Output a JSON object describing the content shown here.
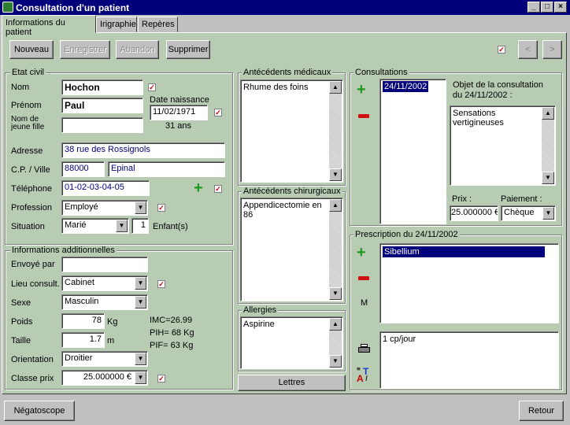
{
  "window": {
    "title": "Consultation d'un patient"
  },
  "tabs": [
    {
      "label": "Informations du patient"
    },
    {
      "label": "Irigraphie"
    },
    {
      "label": "Repères"
    }
  ],
  "toolbar": {
    "nouveau": "Nouveau",
    "enregistrer": "Enregistrer",
    "abandon": "Abandon",
    "supprimer": "Supprimer",
    "prev": "<",
    "next": ">"
  },
  "etat_civil": {
    "title": "Etat civil",
    "nom_label": "Nom",
    "nom": "Hochon",
    "prenom_label": "Prénom",
    "prenom": "Paul",
    "jeune_fille_label": "Nom de jeune fille",
    "jeune_fille": "",
    "date_naissance_label": "Date naissance",
    "date_naissance": "11/02/1971",
    "age": "31 ans",
    "adresse_label": "Adresse",
    "adresse": "38 rue des Rossignols",
    "cp_ville_label": "C.P. / Ville",
    "cp": "88000",
    "ville": "Epinal",
    "telephone_label": "Téléphone",
    "telephone": "01-02-03-04-05",
    "profession_label": "Profession",
    "profession": "Employé",
    "situation_label": "Situation",
    "situation": "Marié",
    "enfants": "1",
    "enfants_label": "Enfant(s)"
  },
  "infos_add": {
    "title": "Informations additionnelles",
    "envoye_label": "Envoyé par",
    "envoye": "",
    "lieu_label": "Lieu consult.",
    "lieu": "Cabinet",
    "sexe_label": "Sexe",
    "sexe": "Masculin",
    "poids_label": "Poids",
    "poids": "78",
    "poids_unit": "Kg",
    "taille_label": "Taille",
    "taille": "1.7",
    "taille_unit": "m",
    "imc": "IMC=26.99",
    "pih": "PIH= 68 Kg",
    "pif": "PIF= 63 Kg",
    "orientation_label": "Orientation",
    "orientation": "Droitier",
    "classe_label": "Classe prix",
    "classe": "25.000000 €"
  },
  "antecedents": {
    "medicaux_title": "Antécédents médicaux",
    "medicaux": "Rhume des foins",
    "chirurgicaux_title": "Antécédents chirurgicaux",
    "chirurgicaux": "Appendicectomie en 86",
    "allergies_title": "Allergies",
    "allergies": "Aspirine",
    "lettres": "Lettres"
  },
  "consultations": {
    "title": "Consultations",
    "items": [
      "24/11/2002"
    ],
    "objet_label": "Objet de la consultation du 24/11/2002 :",
    "objet": "Sensations vertigineuses",
    "prix_label": "Prix :",
    "prix": "25.000000 €",
    "paiement_label": "Paiement :",
    "paiement": "Chèque"
  },
  "prescription": {
    "title": "Prescription du 24/11/2002",
    "items": [
      "Sibellium"
    ],
    "m_label": "M",
    "posologie": "1 cp/jour"
  },
  "footer": {
    "negatoscope": "Négatoscope",
    "retour": "Retour"
  },
  "colors": {
    "panel": "#b8ccb4",
    "titlebar": "#00007b",
    "highlight": "#00007b"
  }
}
